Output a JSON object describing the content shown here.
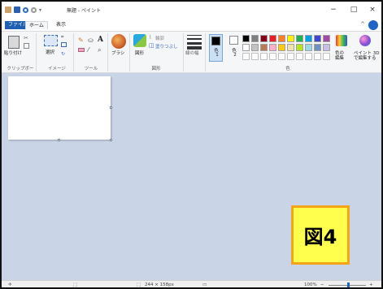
{
  "window": {
    "title": "無題 - ペイント",
    "minimize": "−",
    "maximize": "□",
    "close": "×"
  },
  "tabs": [
    "ファイル",
    "ホーム",
    "表示"
  ],
  "ribbon": {
    "clipboard": {
      "paste_label": "貼り付け",
      "group_label": "クリップボード"
    },
    "image": {
      "select_label": "選択",
      "group_label": "イメージ"
    },
    "tools": {
      "group_label": "ツール"
    },
    "brush": {
      "label": "ブラシ"
    },
    "shapes": {
      "label": "図形",
      "group_label": "図形",
      "outline_label": "輪郭",
      "fill_label": "塗りつぶし"
    },
    "size": {
      "label": "線の幅"
    },
    "color1": {
      "label": "色",
      "num": "1"
    },
    "color2": {
      "label": "色",
      "num": "2"
    },
    "colors": {
      "group_label": "色",
      "edit_label": "色の",
      "edit_label2": "編集",
      "paint3d_label": "ペイント 3D",
      "paint3d_label2": "で編集する",
      "palette_row1": [
        "#000000",
        "#7f7f7f",
        "#880015",
        "#ed1c24",
        "#ff7f27",
        "#fff200",
        "#22b14c",
        "#00a2e8",
        "#3f48cc",
        "#a349a4"
      ],
      "palette_row2": [
        "#ffffff",
        "#c3c3c3",
        "#b97a57",
        "#ffaec9",
        "#ffc90e",
        "#efe4b0",
        "#b5e61d",
        "#99d9ea",
        "#7092be",
        "#c8bfe7"
      ]
    }
  },
  "badge": {
    "text": "図4"
  },
  "status": {
    "canvas_size": "244 × 158px",
    "zoom": "100%",
    "zoom_minus": "−",
    "zoom_plus": "+"
  }
}
